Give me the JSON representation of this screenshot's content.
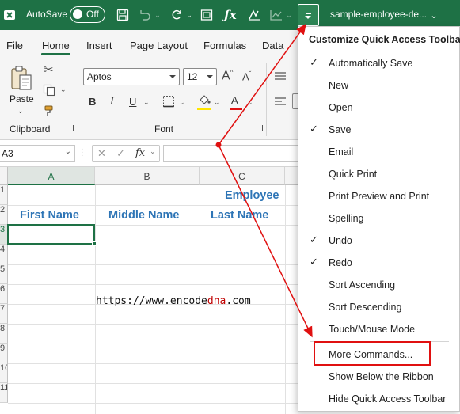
{
  "titlebar": {
    "autosave_label": "AutoSave",
    "autosave_state": "Off",
    "filename": "sample-employee-de...",
    "icons": [
      "save-icon",
      "undo-icon",
      "redo-icon",
      "form-icon",
      "fx-icon",
      "ink-icon",
      "chart-icon"
    ]
  },
  "menu_tabs": [
    "File",
    "Home",
    "Insert",
    "Page Layout",
    "Formulas",
    "Data"
  ],
  "active_tab": "Home",
  "ribbon": {
    "paste_label": "Paste",
    "clipboard_label": "Clipboard",
    "font_label": "Font",
    "font_name": "Aptos",
    "font_size": "12",
    "bold": "B",
    "italic": "I",
    "underline": "U",
    "grow_font": "A",
    "shrink_font": "A",
    "font_color_letter": "A",
    "highlight_color": "#ffe600",
    "font_color": "#e01010"
  },
  "formula_bar": {
    "name_box": "A3",
    "fx": "fx"
  },
  "sheet": {
    "columns": [
      "A",
      "B",
      "C"
    ],
    "rows": [
      "1",
      "2",
      "3",
      "4",
      "5",
      "6",
      "7",
      "8",
      "9",
      "10",
      "11"
    ],
    "title_cell": "Employee",
    "headers": [
      "First Name",
      "Middle Name",
      "Last Name"
    ],
    "header_color": "#2e75b6"
  },
  "watermark": {
    "prefix": "https://www.",
    "brand_a": "encode",
    "brand_b": "dna",
    "suffix": ".com"
  },
  "qat_menu": {
    "title": "Customize Quick Access Toolbar",
    "items": [
      {
        "label": "Automatically Save",
        "checked": true
      },
      {
        "label": "New",
        "checked": false
      },
      {
        "label": "Open",
        "checked": false
      },
      {
        "label": "Save",
        "checked": true
      },
      {
        "label": "Email",
        "checked": false
      },
      {
        "label": "Quick Print",
        "checked": false
      },
      {
        "label": "Print Preview and Print",
        "checked": false
      },
      {
        "label": "Spelling",
        "checked": false
      },
      {
        "label": "Undo",
        "checked": true
      },
      {
        "label": "Redo",
        "checked": true
      },
      {
        "label": "Sort Ascending",
        "checked": false
      },
      {
        "label": "Sort Descending",
        "checked": false
      },
      {
        "label": "Touch/Mouse Mode",
        "checked": false
      },
      {
        "label": "More Commands...",
        "checked": false
      },
      {
        "label": "Show Below the Ribbon",
        "checked": false
      },
      {
        "label": "Hide Quick Access Toolbar",
        "checked": false
      }
    ],
    "check_mark": "✓"
  },
  "annotation_color": "#e01010"
}
